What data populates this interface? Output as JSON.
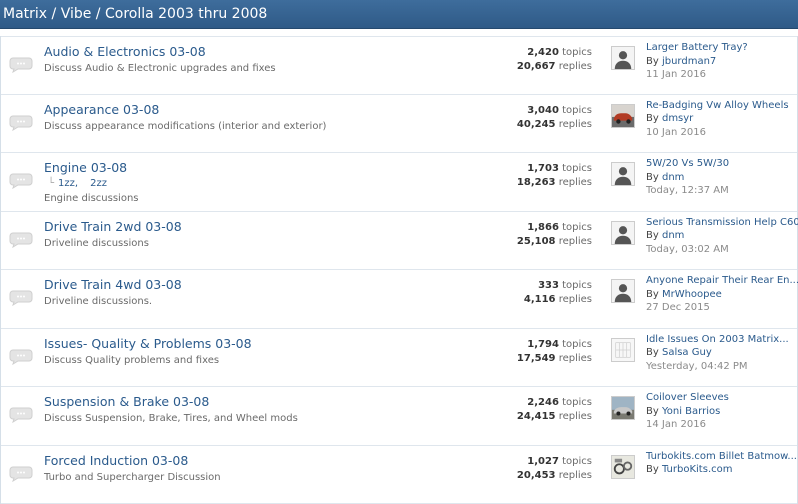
{
  "header": {
    "title": "Matrix / Vibe / Corolla 2003 thru 2008"
  },
  "colors": {
    "header_bg": "#345f8c",
    "link": "#2a5a8c"
  },
  "forums": [
    {
      "title": "Audio & Electronics 03-08",
      "description": "Discuss Audio & Electronic upgrades and fixes",
      "topics": "2,420",
      "topics_label": "topics",
      "replies": "20,667",
      "replies_label": "replies",
      "last_title": "Larger Battery Tray?",
      "last_by": "By",
      "last_user": "jburdman7",
      "last_date": "11 Jan 2016",
      "avatar": "default-avatar"
    },
    {
      "title": "Appearance 03-08",
      "description": "Discuss appearance modifications (interior and exterior)",
      "topics": "3,040",
      "topics_label": "topics",
      "replies": "40,245",
      "replies_label": "replies",
      "last_title": "Re-Badging Vw Alloy Wheels",
      "last_by": "By",
      "last_user": "dmsyr",
      "last_date": "10 Jan 2016",
      "avatar": "car-photo-avatar"
    },
    {
      "title": "Engine 03-08",
      "subforums": [
        "1zz,",
        "2zz"
      ],
      "description": "Engine discussions",
      "topics": "1,703",
      "topics_label": "topics",
      "replies": "18,263",
      "replies_label": "replies",
      "last_title": "5W/20 Vs 5W/30",
      "last_by": "By",
      "last_user": "dnm",
      "last_date": "Today, 12:37 AM",
      "avatar": "default-avatar"
    },
    {
      "title": "Drive Train 2wd 03-08",
      "description": "Driveline discussions",
      "topics": "1,866",
      "topics_label": "topics",
      "replies": "25,108",
      "replies_label": "replies",
      "last_title": "Serious Transmission Help C60",
      "last_by": "By",
      "last_user": "dnm",
      "last_date": "Today, 03:02 AM",
      "avatar": "default-avatar"
    },
    {
      "title": "Drive Train 4wd 03-08",
      "description": "Driveline discussions.",
      "topics": "333",
      "topics_label": "topics",
      "replies": "4,116",
      "replies_label": "replies",
      "last_title": "Anyone Repair Their Rear En...",
      "last_by": "By",
      "last_user": "MrWhoopee",
      "last_date": "27 Dec 2015",
      "avatar": "default-avatar"
    },
    {
      "title": "Issues- Quality & Problems 03-08",
      "description": "Discuss Quality problems and fixes",
      "topics": "1,794",
      "topics_label": "topics",
      "replies": "17,549",
      "replies_label": "replies",
      "last_title": "Idle Issues On 2003 Matrix...",
      "last_by": "By",
      "last_user": "Salsa Guy",
      "last_date": "Yesterday, 04:42 PM",
      "avatar": "grid-avatar"
    },
    {
      "title": "Suspension & Brake 03-08",
      "description": "Discuss Suspension, Brake, Tires, and Wheel mods",
      "topics": "2,246",
      "topics_label": "topics",
      "replies": "24,415",
      "replies_label": "replies",
      "last_title": "Coilover Sleeves",
      "last_by": "By",
      "last_user": "Yoni Barrios",
      "last_date": "14 Jan 2016",
      "avatar": "car-photo-avatar"
    },
    {
      "title": "Forced Induction 03-08",
      "description": "Turbo and Supercharger Discussion",
      "topics": "1,027",
      "topics_label": "topics",
      "replies": "20,453",
      "replies_label": "replies",
      "last_title": "Turbokits.com Billet Batmow...",
      "last_by": "By",
      "last_user": "TurboKits.com",
      "last_date": "",
      "avatar": "product-photo-avatar"
    }
  ]
}
